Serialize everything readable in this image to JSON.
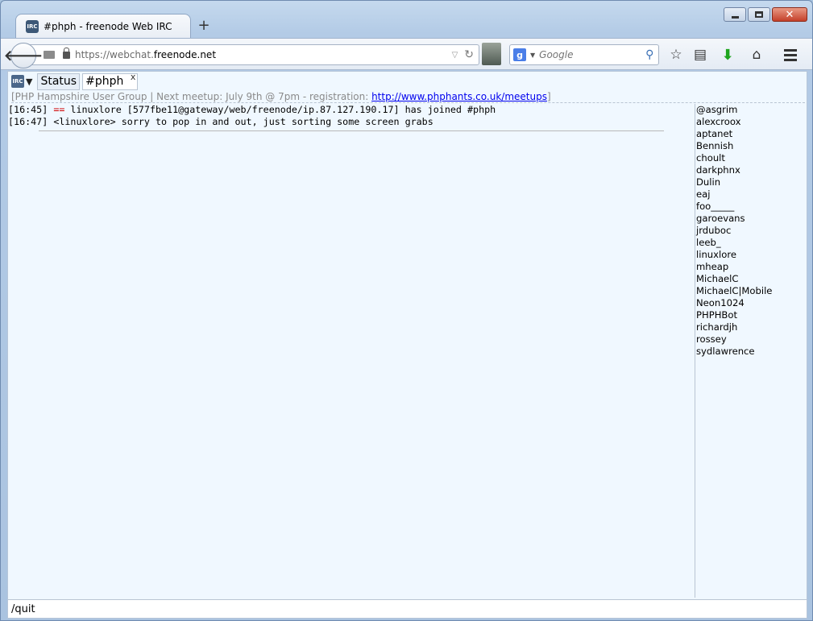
{
  "browser": {
    "tab_title": "#phph - freenode Web IRC",
    "tab_favicon": "IRC",
    "new_tab": "+",
    "url_prefix": "https://webchat.",
    "url_host": "freenode.net",
    "search_placeholder": "Google",
    "search_engine_icon": "g",
    "close_glyph": "✕"
  },
  "irc": {
    "logo": "IRC",
    "dropdown": "▼",
    "tabs": [
      {
        "label": "Status"
      },
      {
        "label": "#phph",
        "close": "x"
      }
    ],
    "topic_prefix": "[PHP Hampshire User Group | Next meetup: July 9th @ 7pm - registration: ",
    "topic_link": "http://www.phphants.co.uk/meetups",
    "topic_suffix": "]",
    "messages": [
      {
        "time": "[16:45]",
        "marker": "==",
        "text": "linuxlore [577fbe11@gateway/web/freenode/ip.87.127.190.17] has joined #phph"
      },
      {
        "time": "[16:47]",
        "text": "<linuxlore> sorry to pop in and out, just sorting some screen grabs"
      }
    ],
    "nicks": [
      "@asgrim",
      "alexcroox",
      "aptanet",
      "Bennish",
      "choult",
      "darkphnx",
      "Dulin",
      "eaj",
      "foo_____",
      "garoevans",
      "jrduboc",
      "leeb_",
      "linuxlore",
      "mheap",
      "MichaelC",
      "MichaelC|Mobile",
      "Neon1024",
      "PHPHBot",
      "richardjh",
      "rossey",
      "sydlawrence"
    ],
    "input_value": "/quit"
  }
}
